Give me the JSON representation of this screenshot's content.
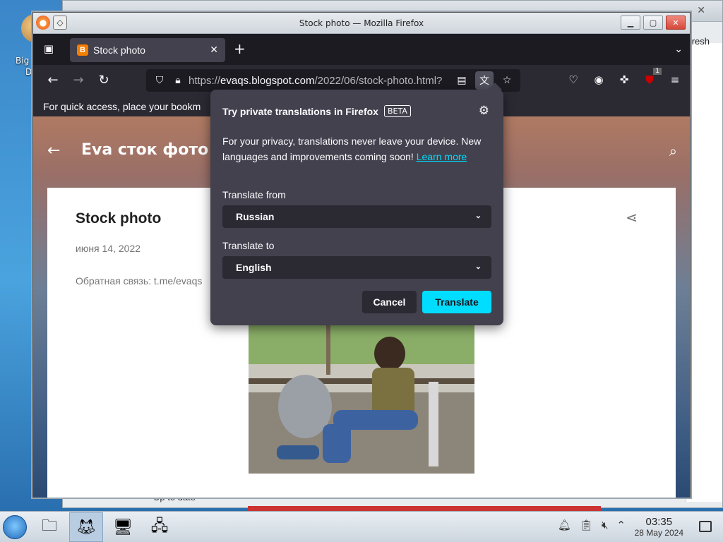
{
  "desktop": {
    "icon_label_line1": "Big",
    "icon_label_line2": "De",
    "bg_window_refresh": "fresh",
    "bg_window_status": "Up to date"
  },
  "window": {
    "title": "Stock photo — Mozilla Firefox"
  },
  "tabs": [
    {
      "title": "Stock photo",
      "favicon": "B"
    }
  ],
  "navbar": {
    "url_scheme_host": "https://",
    "url_domain": "evaqs.blogspot.com",
    "url_path": "/2022/06/stock-photo.html?",
    "extension_badge": "1"
  },
  "bookmarks_bar": {
    "message": "For quick access, place your bookm"
  },
  "page": {
    "site_title": "Eva сток фото",
    "post_title": "Stock photo",
    "post_date": "июня 14, 2022",
    "post_text": "Обратная связь: t.me/evaqs"
  },
  "translation_popup": {
    "title": "Try private translations in Firefox",
    "beta": "BETA",
    "description": "For your privacy, translations never leave your device. New languages and improvements coming soon!",
    "learn_more": "Learn more",
    "from_label": "Translate from",
    "from_value": "Russian",
    "to_label": "Translate to",
    "to_value": "English",
    "cancel": "Cancel",
    "translate": "Translate"
  },
  "taskbar": {
    "time": "03:35",
    "date": "28 May 2024"
  },
  "colors": {
    "accent": "#00ddff",
    "popup_bg": "#42414d",
    "toolbar_bg": "#2b2a33"
  }
}
